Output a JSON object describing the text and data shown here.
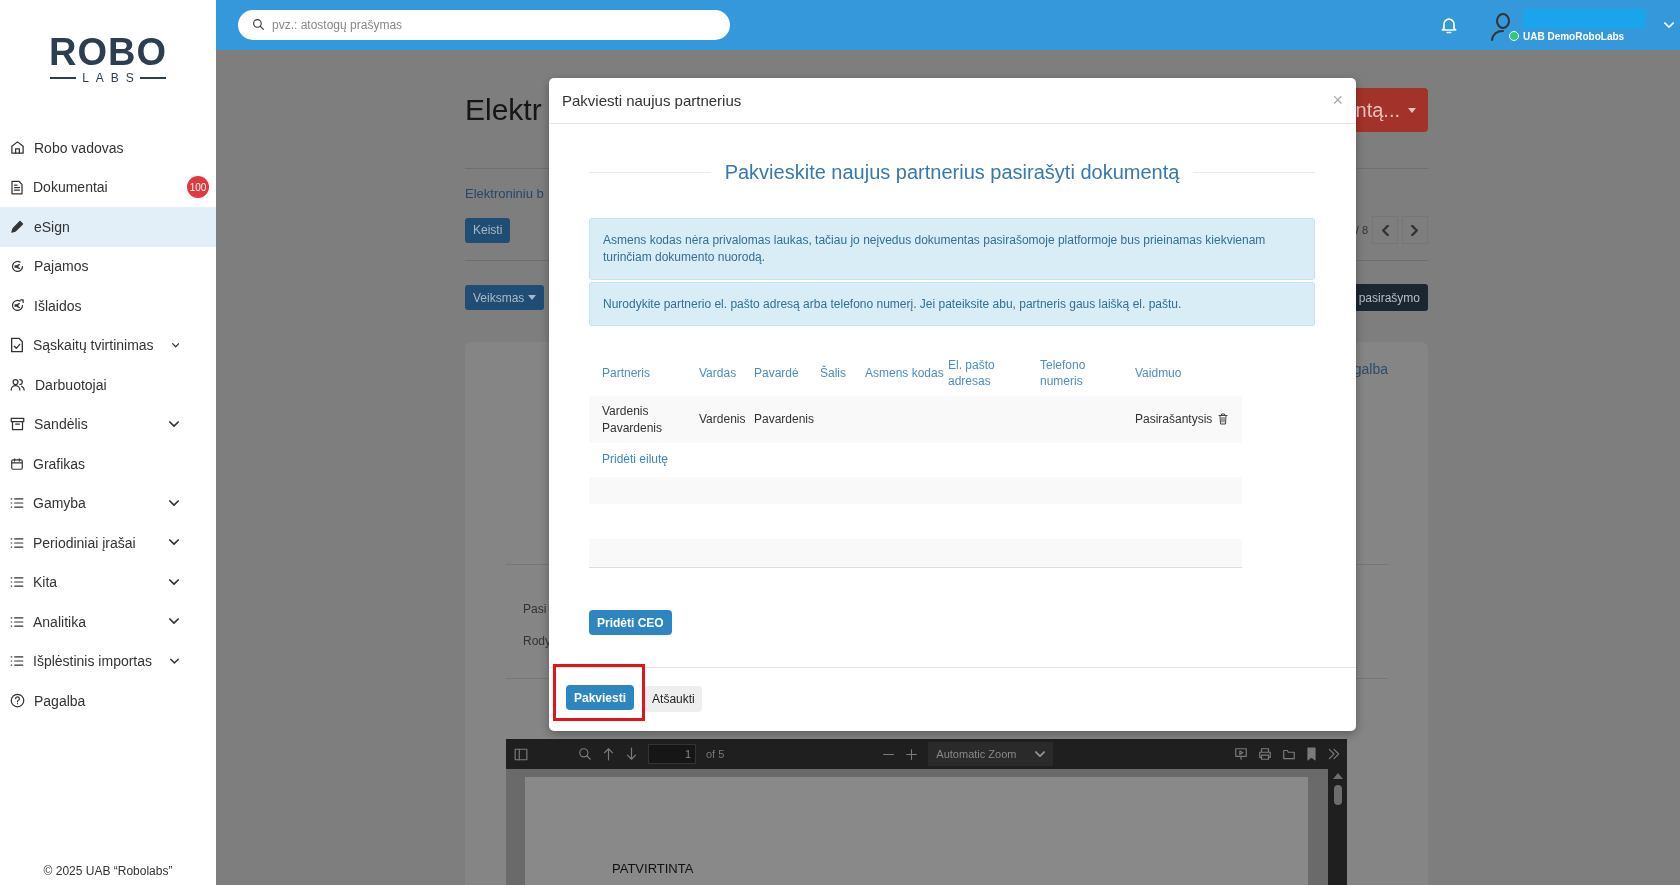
{
  "sidebar": {
    "logo": {
      "word": "ROBO",
      "subword": "LABS"
    },
    "items": [
      {
        "label": "Robo vadovas",
        "kind": "home",
        "selected": false,
        "expandable": false
      },
      {
        "label": "Dokumentai",
        "kind": "document",
        "selected": false,
        "expandable": false,
        "badge": "100"
      },
      {
        "label": "eSign",
        "kind": "pen",
        "selected": true,
        "expandable": false
      },
      {
        "label": "Pajamos",
        "kind": "income",
        "selected": false,
        "expandable": false
      },
      {
        "label": "Išlaidos",
        "kind": "expense",
        "selected": false,
        "expandable": false
      },
      {
        "label": "Sąskaitų tvirtinimas",
        "kind": "invoice",
        "selected": false,
        "expandable": true
      },
      {
        "label": "Darbuotojai",
        "kind": "people",
        "selected": false,
        "expandable": false
      },
      {
        "label": "Sandėlis",
        "kind": "archive",
        "selected": false,
        "expandable": true
      },
      {
        "label": "Grafikas",
        "kind": "calendar",
        "selected": false,
        "expandable": false
      },
      {
        "label": "Gamyba",
        "kind": "list",
        "selected": false,
        "expandable": true
      },
      {
        "label": "Periodiniai įrašai",
        "kind": "list",
        "selected": false,
        "expandable": true
      },
      {
        "label": "Kita",
        "kind": "list",
        "selected": false,
        "expandable": true
      },
      {
        "label": "Analitika",
        "kind": "list",
        "selected": false,
        "expandable": true
      },
      {
        "label": "Išplėstinis importas",
        "kind": "list",
        "selected": false,
        "expandable": true
      },
      {
        "label": "Pagalba",
        "kind": "help",
        "selected": false,
        "expandable": false
      }
    ],
    "footer": "© 2025 UAB “Robolabs”"
  },
  "header": {
    "search": {
      "placeholder": "pvz.: atostogų prašymas"
    },
    "company": "UAB DemoRoboLabs"
  },
  "page": {
    "title": "Elektr",
    "action_button": "ntą...",
    "subtitle": "Elektroniniu b",
    "edit_button": "Keisti",
    "pager": "/ 8",
    "actions_button": "Veiksmas",
    "sign_button": "pasirašymo",
    "help_link": "galba",
    "line_1": "Pasi",
    "line_2": "Rody"
  },
  "pdf_viewer": {
    "page_number": "1",
    "page_count": "of 5",
    "zoom": "Automatic Zoom",
    "page_text": "PATVIRTINTA"
  },
  "modal": {
    "title": "Pakviesti naujus partnerius",
    "close": "×",
    "heading": "Pakvieskite naujus partnerius pasirašyti dokumentą",
    "alerts": [
      "Asmens kodas nėra privalomas laukas, tačiau jo neįvedus dokumentas pasirašomoje platformoje bus prieinamas kiekvienam turinčiam dokumento nuorodą.",
      "Nurodykite partnerio el. pašto adresą arba telefono numerį. Jei pateiksite abu, partneris gaus laišką el. paštu."
    ],
    "table": {
      "columns": [
        "Partneris",
        "Vardas",
        "Pavardė",
        "Šalis",
        "Asmens kodas",
        "El. pašto adresas",
        "Telefono numeris",
        "Vaidmuo"
      ],
      "rows": [
        {
          "partner": "Vardenis Pavardenis",
          "first_name": "Vardenis",
          "last_name": "Pavardenis",
          "role": "Pasirašantysis"
        }
      ]
    },
    "add_row_link": "Pridėti eilutę",
    "add_ceo_button": "Pridėti CEO",
    "buttons": [
      {
        "label": "Pakviesti",
        "kind": "primary",
        "highlighted": true
      },
      {
        "label": "Atšaukti",
        "kind": "secondary",
        "highlighted": false
      }
    ]
  }
}
